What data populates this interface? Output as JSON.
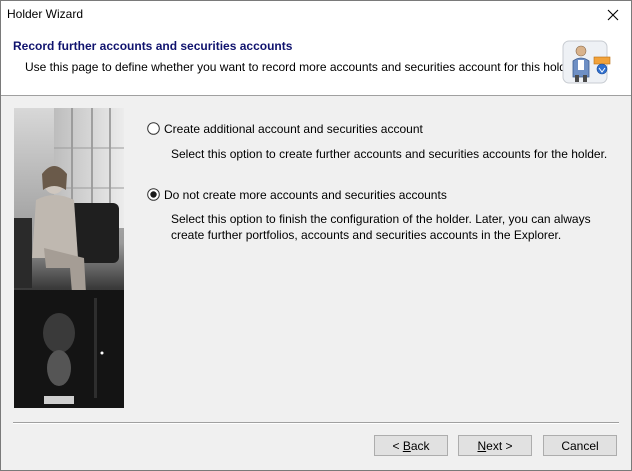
{
  "window": {
    "title": "Holder Wizard",
    "close_glyph": "✕"
  },
  "header": {
    "title": "Record further accounts and securities accounts",
    "subtitle": "Use this page to define whether you want to record more accounts and securities account for this holder.",
    "icon": "holder-wizard-icon"
  },
  "options": [
    {
      "label": "Create additional account and securities account",
      "description": "Select this option to create further accounts and securities accounts for the holder.",
      "selected": false
    },
    {
      "label": "Do not create more accounts and securities accounts",
      "description": "Select this option to finish the configuration of the holder. Later, you can always create further portfolios, accounts and securities accounts in the Explorer.",
      "selected": true
    }
  ],
  "buttons": {
    "back_mnemonic": "B",
    "back_rest": "ack",
    "back_prefix": "< ",
    "next_mnemonic": "N",
    "next_rest": "ext >",
    "cancel": "Cancel"
  },
  "colors": {
    "header_title": "#10136e",
    "button_face": "#e1e1e1"
  }
}
